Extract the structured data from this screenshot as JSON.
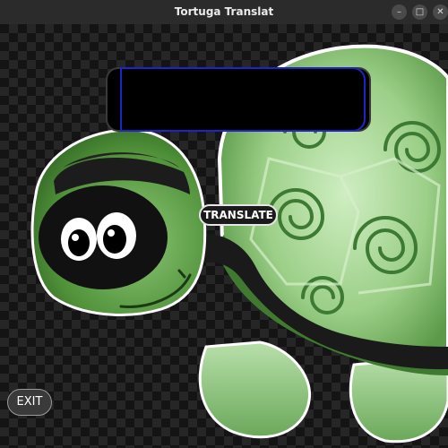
{
  "window": {
    "title": "Tortuga Translat",
    "controls": {
      "minimize": "–",
      "maximize": "□",
      "close": "✕"
    }
  },
  "output": {
    "text": ""
  },
  "buttons": {
    "translate": "TRANSLATE",
    "exit": "EXIT"
  },
  "icons": {
    "illustration": "cartoon-turtle-illustration"
  },
  "colors": {
    "titlebar": "#2b2b2b",
    "output_border": "#1e24c8",
    "turtle_green": "#5a9a48",
    "turtle_light_green": "#a8d49a",
    "background_checker": "#262626"
  }
}
